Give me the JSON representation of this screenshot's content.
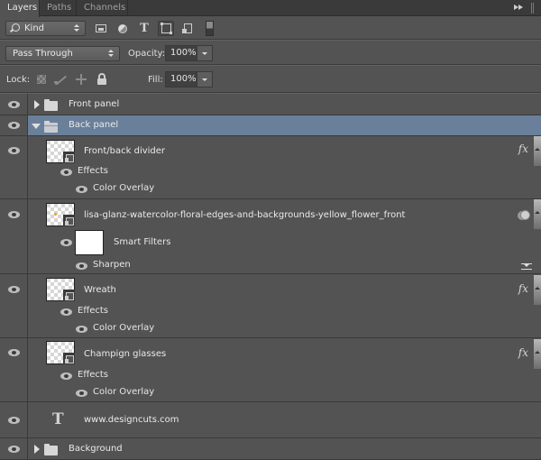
{
  "tabs": [
    {
      "label": "Layers",
      "active": true
    },
    {
      "label": "Paths",
      "active": false
    },
    {
      "label": "Channels",
      "active": false
    }
  ],
  "panel_menu_icon": "double-chevron-right-icon",
  "filter": {
    "kind_label": "Kind",
    "icons": [
      "pixel-layer-filter-icon",
      "adjustment-layer-filter-icon",
      "type-layer-filter-icon",
      "shape-layer-filter-icon",
      "smart-object-filter-icon"
    ],
    "active_icon": "shape-layer-filter-icon",
    "type_glyph": "T"
  },
  "blend_mode": "Pass Through",
  "opacity": {
    "label": "Opacity:",
    "value": "100%"
  },
  "lock": {
    "label": "Lock:",
    "icons": [
      "lock-transparent-pixels-icon",
      "lock-image-pixels-icon",
      "lock-position-icon",
      "lock-all-icon"
    ]
  },
  "fill": {
    "label": "Fill:",
    "value": "100%"
  },
  "selection_color": "#6a7f99",
  "layers": [
    {
      "name": "Front panel",
      "type": "group",
      "expanded": false,
      "visible": true,
      "selected": false
    },
    {
      "name": "Back panel",
      "type": "group",
      "expanded": true,
      "visible": true,
      "selected": true
    },
    {
      "name": "Front/back divider",
      "type": "smart-object",
      "visible": true,
      "badge": "fx",
      "effects_label": "Effects",
      "effects": [
        "Color Overlay"
      ]
    },
    {
      "name": "lisa-glanz-watercolor-floral-edges-and-backgrounds-yellow_flower_front",
      "type": "smart-object",
      "visible": true,
      "badge": "smart-filter",
      "smart_filters_label": "Smart Filters",
      "filters": [
        "Sharpen"
      ]
    },
    {
      "name": "Wreath",
      "type": "smart-object",
      "visible": true,
      "badge": "fx",
      "effects_label": "Effects",
      "effects": [
        "Color Overlay"
      ]
    },
    {
      "name": "Champign glasses",
      "type": "smart-object",
      "visible": true,
      "badge": "fx",
      "effects_label": "Effects",
      "effects": [
        "Color Overlay"
      ]
    },
    {
      "name": "www.designcuts.com",
      "type": "text",
      "visible": true,
      "glyph": "T"
    },
    {
      "name": "Background",
      "type": "group",
      "expanded": false,
      "visible": true,
      "selected": false
    }
  ],
  "fx_glyph": "fx"
}
